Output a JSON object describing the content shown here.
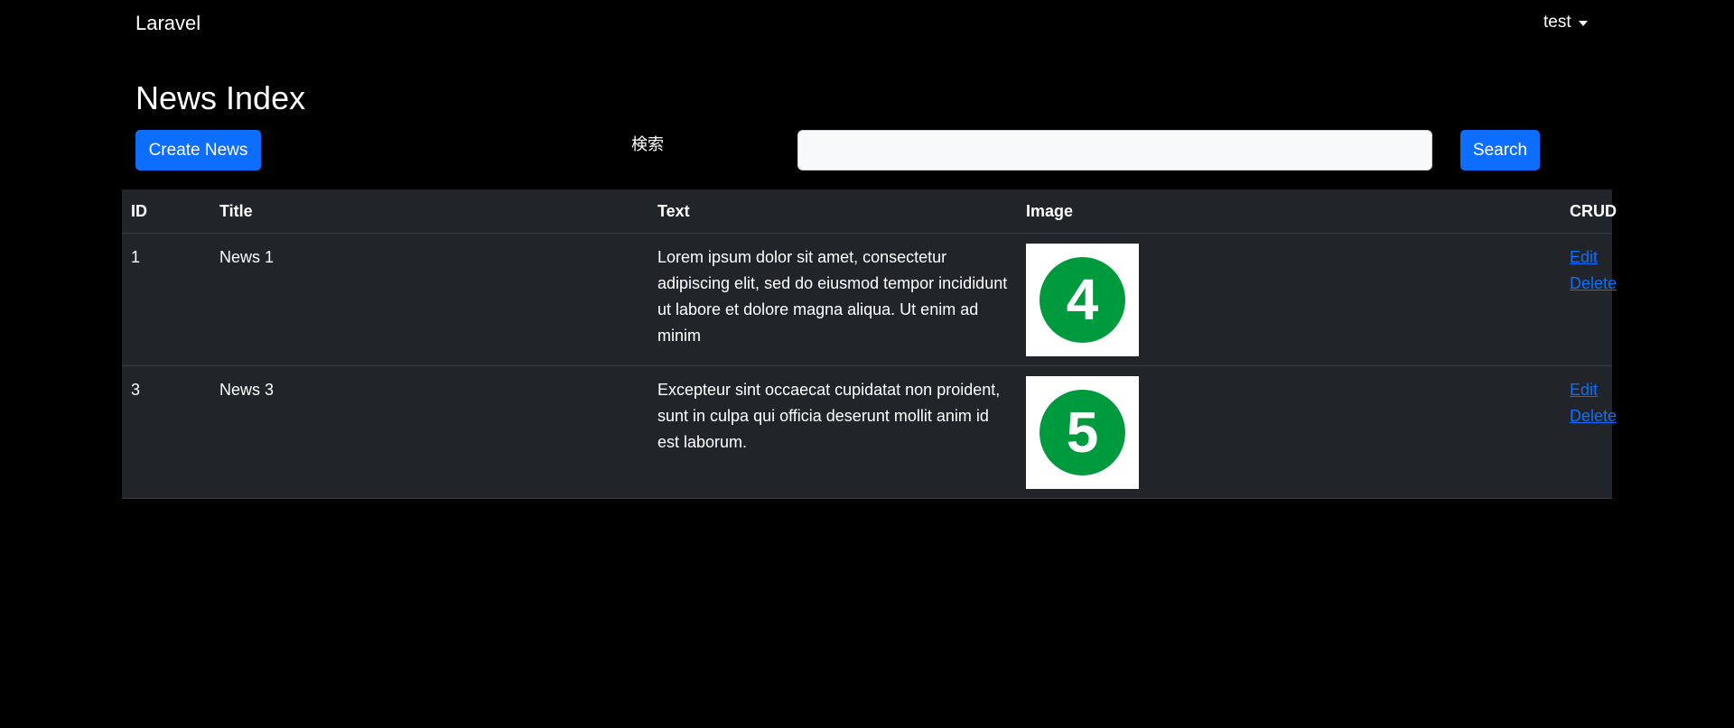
{
  "nav": {
    "brand": "Laravel",
    "user": "test"
  },
  "page": {
    "title": "News Index",
    "create_label": "Create News",
    "search_label": "検索",
    "search_value": "",
    "search_button": "Search"
  },
  "table": {
    "headers": [
      "ID",
      "Title",
      "Text",
      "Image",
      "CRUD"
    ],
    "rows": [
      {
        "id": "1",
        "title": "News 1",
        "text": "Lorem ipsum dolor sit amet, consectetur adipiscing elit, sed do eiusmod tempor incididunt ut labore et dolore magna aliqua. Ut enim ad minim",
        "image_number": "4",
        "edit": "Edit",
        "delete": "Delete"
      },
      {
        "id": "3",
        "title": "News 3",
        "text": "Excepteur sint occaecat cupidatat non proident, sunt in culpa qui officia deserunt mollit anim id est laborum.",
        "image_number": "5",
        "edit": "Edit",
        "delete": "Delete"
      }
    ]
  },
  "colors": {
    "background": "#000000",
    "table_bg": "#212529",
    "primary": "#0d6efd",
    "badge_green": "#009a3e"
  }
}
